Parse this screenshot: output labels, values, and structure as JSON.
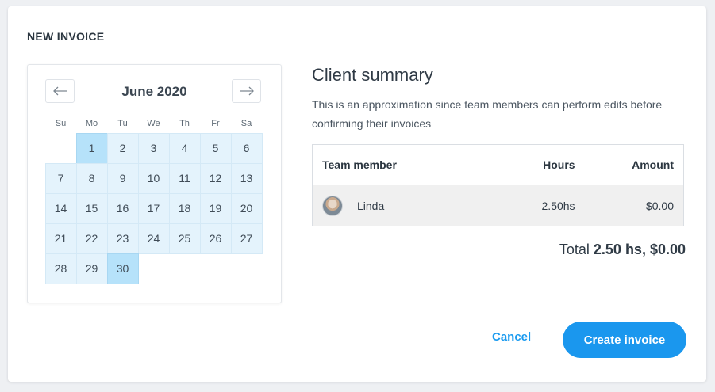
{
  "dialog": {
    "title": "NEW INVOICE"
  },
  "calendar": {
    "month_label": "June 2020",
    "prev_icon": "arrow-left-icon",
    "next_icon": "arrow-right-icon",
    "weekdays": [
      "Su",
      "Mo",
      "Tu",
      "We",
      "Th",
      "Fr",
      "Sa"
    ],
    "first_weekday_offset": 1,
    "days": [
      "1",
      "2",
      "3",
      "4",
      "5",
      "6",
      "7",
      "8",
      "9",
      "10",
      "11",
      "12",
      "13",
      "14",
      "15",
      "16",
      "17",
      "18",
      "19",
      "20",
      "21",
      "22",
      "23",
      "24",
      "25",
      "26",
      "27",
      "28",
      "29",
      "30"
    ],
    "selected_days": [
      "1",
      "30"
    ],
    "range_color": "#e4f3fc",
    "selected_color": "#b6e2fa"
  },
  "summary": {
    "heading": "Client summary",
    "description": "This is an approximation since team members can perform edits before confirming their invoices",
    "table": {
      "headers": {
        "member": "Team member",
        "hours": "Hours",
        "amount": "Amount"
      },
      "rows": [
        {
          "member": "Linda",
          "hours": "2.50hs",
          "amount": "$0.00"
        }
      ]
    },
    "total_label": "Total",
    "total_value": "2.50 hs, $0.00"
  },
  "actions": {
    "cancel_label": "Cancel",
    "create_label": "Create invoice",
    "accent_color": "#1a97ee"
  }
}
